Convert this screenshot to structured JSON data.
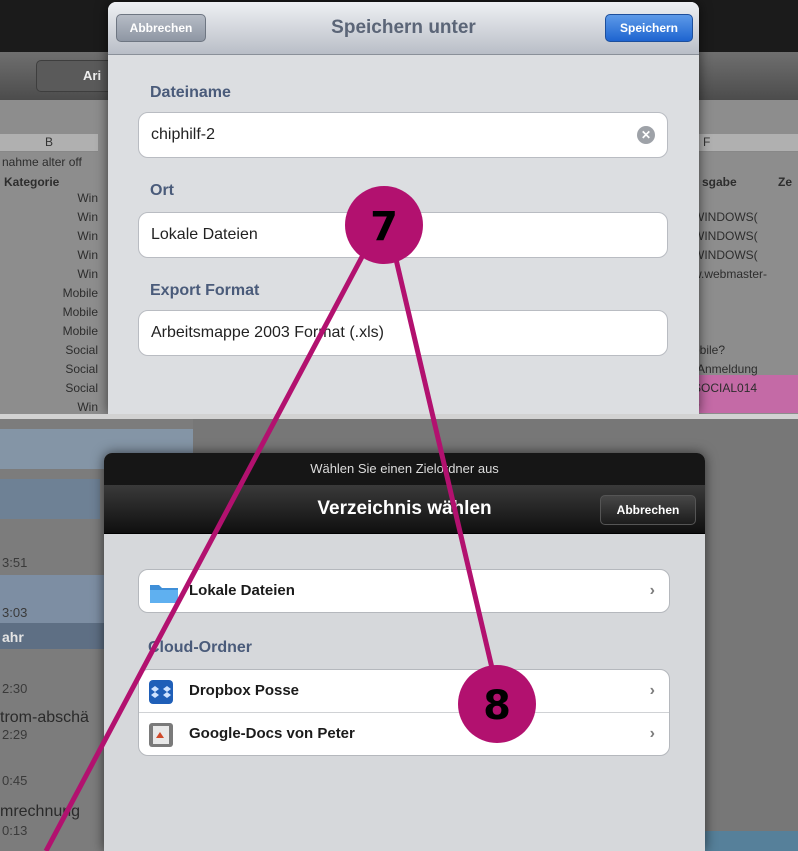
{
  "top": {
    "toolbar_partial": "Ari",
    "sheet": {
      "col_b": "B",
      "col_f": "F",
      "col_b_title": "nahme alter off",
      "kategorie_header": "Kategorie",
      "categories": [
        "Win",
        "Win",
        "Win",
        "Win",
        "Win",
        "Mobile",
        "Mobile",
        "Mobile",
        "Social",
        "Social",
        "Social",
        "Win"
      ],
      "right_header_1": "sgabe",
      "right_header_2": "Ze",
      "right_cells": [
        "WINDOWS(",
        "WINDOWS(",
        "WINDOWS(",
        "w.webmaster-",
        "",
        "",
        "obile?",
        "-Anmeldung",
        "SOCIAL014",
        "?"
      ]
    },
    "dialog": {
      "title": "Speichern unter",
      "cancel_label": "Abbrechen",
      "save_label": "Speichern",
      "filename_label": "Dateiname",
      "filename_value": "chiphilf-2",
      "location_label": "Ort",
      "location_value": "Lokale Dateien",
      "format_label": "Export Format",
      "format_value": "Arbeitsmappe 2003 Format (.xls)"
    }
  },
  "bottom": {
    "left_list": {
      "times": [
        "3:51",
        "3:03",
        "2:30",
        "2:29",
        "0:45",
        "0:13"
      ],
      "section_header": "ahr",
      "items": [
        "trom-abschä",
        "mrechnung"
      ]
    },
    "dialog": {
      "prompt": "Wählen Sie einen Zielordner aus",
      "title": "Verzeichnis wählen",
      "cancel_label": "Abbrechen",
      "local_item": "Lokale Dateien",
      "cloud_section": "Cloud-Ordner",
      "cloud_items": [
        "Dropbox Posse",
        "Google-Docs von Peter"
      ]
    }
  },
  "callouts": {
    "first": "7",
    "second": "8"
  },
  "colors": {
    "accent_magenta": "#b2116f",
    "save_blue": "#2a6fd6",
    "section_text": "#4a5b7a"
  }
}
